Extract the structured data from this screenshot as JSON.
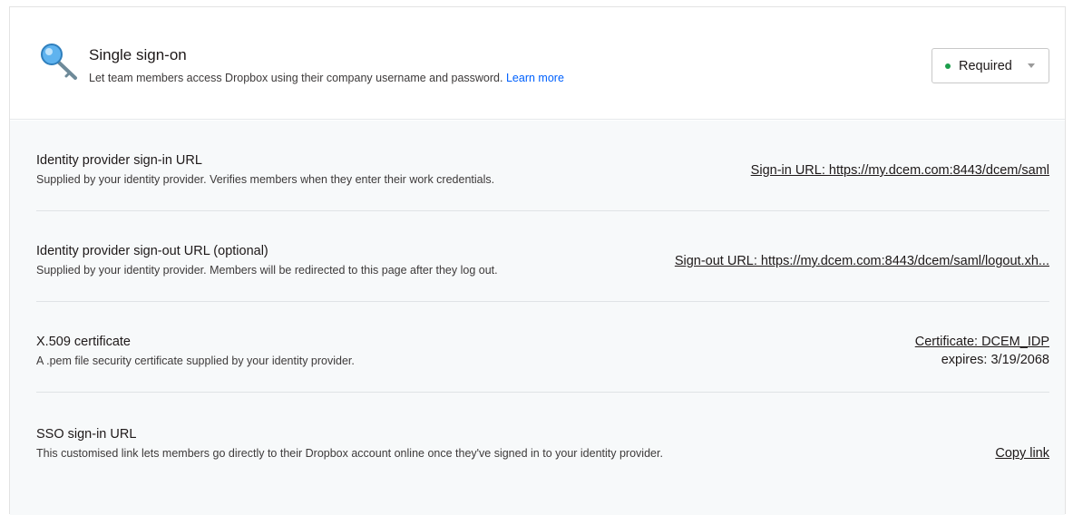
{
  "header": {
    "title": "Single sign-on",
    "description": "Let team members access Dropbox using their company username and password.",
    "learn_more": "Learn more",
    "icon": "key-magnifier-icon"
  },
  "status_dropdown": {
    "selected": "Required",
    "status_color": "#1b9e4b"
  },
  "rows": [
    {
      "title": "Identity provider sign-in URL",
      "description": "Supplied by your identity provider. Verifies members when they enter their work credentials.",
      "link": "Sign-in URL: https://my.dcem.com:8443/dcem/saml"
    },
    {
      "title": "Identity provider sign-out URL (optional)",
      "description": "Supplied by your identity provider. Members will be redirected to this page after they log out.",
      "link": "Sign-out URL: https://my.dcem.com:8443/dcem/saml/logout.xh..."
    },
    {
      "title": "X.509 certificate",
      "description": "A .pem file security certificate supplied by your identity provider.",
      "link": "Certificate: DCEM_IDP",
      "note": "expires: 3/19/2068"
    },
    {
      "title": "SSO sign-in URL",
      "description": "This customised link lets members go directly to their Dropbox account online once they've signed in to your identity provider.",
      "link": "Copy link"
    }
  ],
  "colors": {
    "link": "#0061fe",
    "body_bg": "#f7f9fa"
  }
}
